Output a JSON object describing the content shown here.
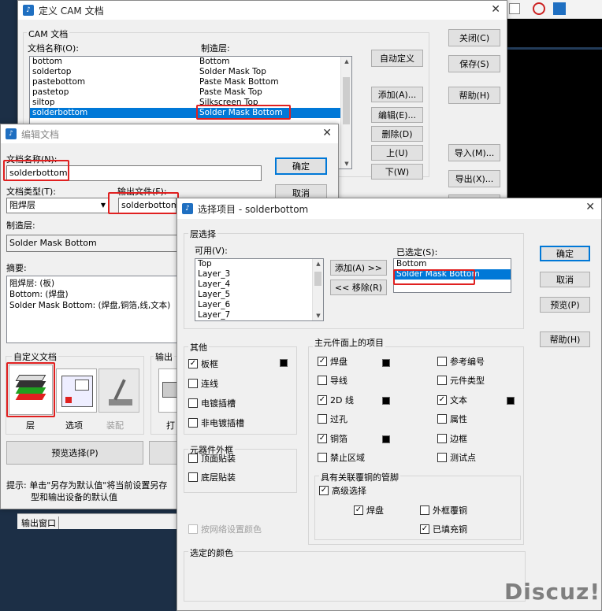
{
  "taskbar": {
    "output_window_label": "输出窗口"
  },
  "watermark": "Discuz!",
  "cam_window": {
    "title": "定义 CAM 文档",
    "group_label": "CAM 文档",
    "col_name_label": "文档名称(O):",
    "col_layer_label": "制造层:",
    "docs": [
      {
        "name": "bottom",
        "layer": "Bottom"
      },
      {
        "name": "soldertop",
        "layer": "Solder Mask Top"
      },
      {
        "name": "pastebottom",
        "layer": "Paste Mask Bottom"
      },
      {
        "name": "pastetop",
        "layer": "Paste Mask Top"
      },
      {
        "name": "siltop",
        "layer": "Silkscreen Top"
      },
      {
        "name": "solderbottom",
        "layer": "Solder Mask Bottom",
        "selected": true
      }
    ],
    "buttons": {
      "custom": "自动定义",
      "add": "添加(A)...",
      "edit": "编辑(E)...",
      "delete": "删除(D)",
      "up": "上(U)",
      "down": "下(W)",
      "close": "关闭(C)",
      "save": "保存(S)",
      "help": "帮助(H)",
      "import": "导入(M)...",
      "export": "导出(X)..."
    }
  },
  "edit_window": {
    "title": "编辑文档",
    "doc_name_label": "文档名称(N):",
    "doc_name_value": "solderbottom",
    "ok": "确定",
    "cancel": "取消",
    "doc_type_label": "文档类型(T):",
    "doc_type_value": "阻焊层",
    "output_file_label": "输出文件(F):",
    "output_file_value": "solderbottom",
    "layer_label": "制造层:",
    "layer_value": "Solder Mask Bottom",
    "summary_label": "摘要:",
    "summary_lines": [
      "阻焊层: (板)",
      "Bottom: (焊盘)",
      "Solder Mask Bottom: (焊盘,铜箔,线,文本)"
    ],
    "custom_doc_label": "自定义文档",
    "output_label": "输出",
    "icon_layer_label": "层",
    "icon_options_label": "选项",
    "icon_assembly_label": "装配",
    "icon_print_label": "打",
    "preview_btn": "预览选择(P)",
    "hint_line1": "提示: 单击\"另存为默认值\"将当前设置另存",
    "hint_line2": "型和输出设备的默认值"
  },
  "select_window": {
    "title": "选择项目 - solderbottom",
    "layer_group_label": "层选择",
    "available_label": "可用(V):",
    "available": [
      "Top",
      "Layer_3",
      "Layer_4",
      "Layer_5",
      "Layer_6",
      "Layer_7"
    ],
    "selected_label": "已选定(S):",
    "selected": [
      "Bottom",
      "Solder Mask Bottom"
    ],
    "add_btn": "添加(A) >>",
    "remove_btn": "<< 移除(R)",
    "ok": "确定",
    "cancel": "取消",
    "preview": "预览(P)",
    "help": "帮助(H)",
    "other_label": "其他",
    "other": [
      {
        "label": "板框",
        "checked": true
      },
      {
        "label": "连线",
        "checked": false
      },
      {
        "label": "电镀插槽",
        "checked": false
      },
      {
        "label": "非电镀插槽",
        "checked": false
      }
    ],
    "outline_label": "元器件外框",
    "outline": [
      {
        "label": "顶面贴装",
        "checked": false
      },
      {
        "label": "底层贴装",
        "checked": false
      }
    ],
    "net_color_label": "按网络设置颜色",
    "main_items_label": "主元件面上的项目",
    "main_left": [
      {
        "label": "焊盘",
        "checked": true
      },
      {
        "label": "导线",
        "checked": false
      },
      {
        "label": "2D 线",
        "checked": true
      },
      {
        "label": "过孔",
        "checked": false
      },
      {
        "label": "铜箔",
        "checked": true
      },
      {
        "label": "禁止区域",
        "checked": false
      }
    ],
    "main_right": [
      {
        "label": "参考编号",
        "checked": false
      },
      {
        "label": "元件类型",
        "checked": false
      },
      {
        "label": "文本",
        "checked": true
      },
      {
        "label": "属性",
        "checked": false
      },
      {
        "label": "边框",
        "checked": false
      },
      {
        "label": "测试点",
        "checked": false
      }
    ],
    "copper_group_label": "具有关联覆铜的管脚",
    "advanced_label": "高级选择",
    "pad_label": "焊盘",
    "outline_copper_label": "外框覆铜",
    "filled_copper_label": "已填充铜",
    "selected_colors_label": "选定的颜色"
  }
}
